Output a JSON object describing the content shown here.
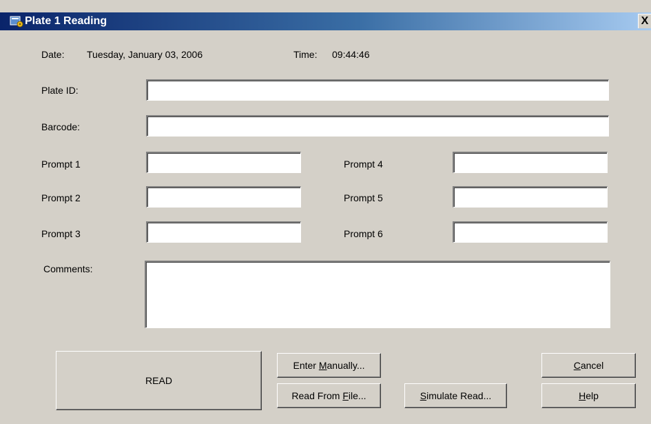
{
  "window": {
    "title": "Plate 1 Reading",
    "close_glyph": "X"
  },
  "header": {
    "date_label": "Date:",
    "date_value": "Tuesday, January 03, 2006",
    "time_label": "Time:",
    "time_value": "09:44:46"
  },
  "form": {
    "plate_id": {
      "label": "Plate ID:",
      "value": ""
    },
    "barcode": {
      "label": "Barcode:",
      "value": ""
    },
    "prompts": [
      {
        "label": "Prompt 1",
        "value": ""
      },
      {
        "label": "Prompt 2",
        "value": ""
      },
      {
        "label": "Prompt 3",
        "value": ""
      },
      {
        "label": "Prompt 4",
        "value": ""
      },
      {
        "label": "Prompt 5",
        "value": ""
      },
      {
        "label": "Prompt 6",
        "value": ""
      }
    ],
    "comments": {
      "label": "Comments:",
      "value": ""
    }
  },
  "buttons": {
    "read": {
      "label": "READ"
    },
    "enter_manually": {
      "pre": "Enter ",
      "accel": "M",
      "post": "anually..."
    },
    "read_from_file": {
      "pre": "Read From ",
      "accel": "F",
      "post": "ile..."
    },
    "simulate_read": {
      "pre": "",
      "accel": "S",
      "post": "imulate Read..."
    },
    "cancel": {
      "pre": "",
      "accel": "C",
      "post": "ancel"
    },
    "help": {
      "pre": "",
      "accel": "H",
      "post": "elp"
    }
  },
  "icons": {
    "title_icon": "plate-reader-icon",
    "close_icon": "close-icon"
  }
}
